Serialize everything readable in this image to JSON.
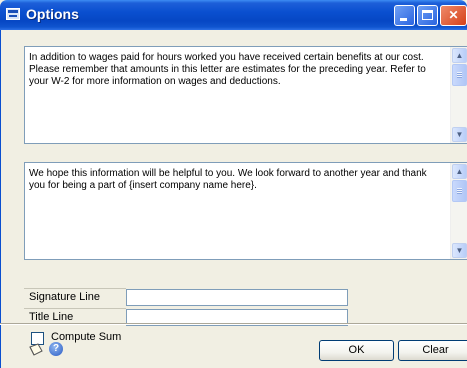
{
  "window": {
    "title": "Options"
  },
  "textboxes": {
    "top": {
      "text": "In addition to wages paid for hours worked you have received certain benefits at our cost.  Please remember that amounts in this letter are estimates for the preceding year.  Refer to your W-2 for more information on wages and deductions."
    },
    "bottom": {
      "text": "We hope this information will be helpful to you.  We look forward to another year and thank you for being a part of {insert company name here}."
    }
  },
  "fields": {
    "signature_label": "Signature Line",
    "signature_value": "",
    "title_label": "Title Line",
    "title_value": ""
  },
  "compute_sum": {
    "label": "Compute Sum",
    "checked": false
  },
  "buttons": {
    "ok": "OK",
    "clear": "Clear"
  },
  "icons": {
    "window": "options-window-icon",
    "minimize": "minimize-icon",
    "maximize": "maximize-icon",
    "close": "close-icon",
    "scroll_up": "scroll-up-arrow-icon",
    "scroll_down": "scroll-down-arrow-icon",
    "note": "note-pencil-icon",
    "help": "help-icon"
  },
  "colors": {
    "titlebar": "#0a4fd0",
    "close_button": "#d5411a",
    "dialog_background": "#f1efe3"
  }
}
